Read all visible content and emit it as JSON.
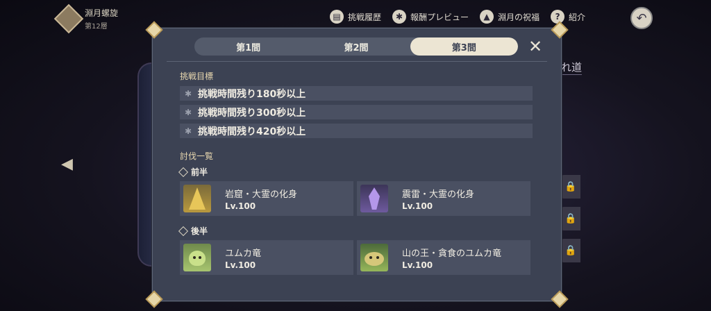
{
  "header": {
    "title": "淵月螺旋",
    "floor": "第12層",
    "actions": [
      {
        "label": "挑戦履歴",
        "icon": "book-icon",
        "glyph": "▤"
      },
      {
        "label": "報酬プレビュー",
        "icon": "reward-icon",
        "glyph": "✱"
      },
      {
        "label": "淵月の祝福",
        "icon": "blessing-icon",
        "glyph": "▲"
      },
      {
        "label": "紹介",
        "icon": "help-icon",
        "glyph": "?"
      }
    ],
    "back_glyph": "↶"
  },
  "background": {
    "side_arrow_glyph": "◀",
    "right_text": "れ道",
    "lock_glyph": "🔒"
  },
  "panel": {
    "tabs": [
      {
        "label": "第1間",
        "active": false
      },
      {
        "label": "第2間",
        "active": false
      },
      {
        "label": "第3間",
        "active": true
      }
    ],
    "close_glyph": "✕",
    "challenge_label": "挑戦目標",
    "goals": [
      "挑戦時間残り180秒以上",
      "挑戦時間残り300秒以上",
      "挑戦時間残り420秒以上"
    ],
    "goal_star_glyph": "✱",
    "enemy_list_label": "討伐一覧",
    "first_half": {
      "label": "前半",
      "enemies": [
        {
          "name": "岩窟・大霊の化身",
          "level": "Lv.100",
          "portrait": "rock-spirit"
        },
        {
          "name": "震雷・大霊の化身",
          "level": "Lv.100",
          "portrait": "electro-spirit"
        }
      ]
    },
    "second_half": {
      "label": "後半",
      "enemies": [
        {
          "name": "ユムカ竜",
          "level": "Lv.100",
          "portrait": "yumkasaur"
        },
        {
          "name": "山の王・貪食のユムカ竜",
          "level": "Lv.100",
          "portrait": "yumkasaur-king"
        }
      ]
    }
  },
  "colors": {
    "panel_bg": "#3c4253",
    "row_bg": "#4a5062",
    "tab_active_bg": "#ece5d3",
    "section_label": "#ead9b0",
    "corner_gold": "#e6d6a8"
  }
}
